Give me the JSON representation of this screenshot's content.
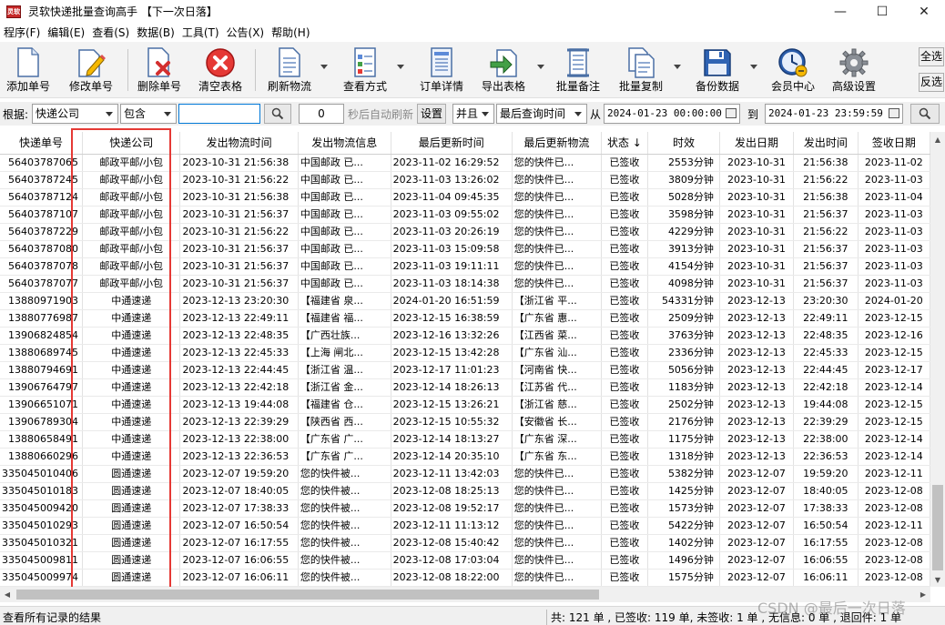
{
  "window": {
    "title": "灵软快递批量查询高手 【下一次日落】",
    "app_icon_text": "灵软",
    "minimize": "—",
    "maximize": "☐",
    "close": "✕"
  },
  "menu": [
    "程序(F)",
    "编辑(E)",
    "查看(S)",
    "数据(B)",
    "工具(T)",
    "公告(X)",
    "帮助(H)"
  ],
  "toolbar": {
    "buttons": [
      {
        "label": "添加单号",
        "icon": "add-document-icon"
      },
      {
        "label": "修改单号",
        "icon": "edit-pencil-icon"
      },
      {
        "label": "删除单号",
        "icon": "delete-document-icon"
      },
      {
        "label": "清空表格",
        "icon": "clear-red-x-icon"
      },
      {
        "label": "刷新物流",
        "icon": "refresh-document-icon"
      },
      {
        "label": "查看方式",
        "icon": "view-mode-icon"
      },
      {
        "label": "订单详情",
        "icon": "order-detail-icon"
      },
      {
        "label": "导出表格",
        "icon": "export-arrow-icon"
      },
      {
        "label": "批量备注",
        "icon": "batch-note-icon"
      },
      {
        "label": "批量复制",
        "icon": "batch-copy-icon"
      },
      {
        "label": "备份数据",
        "icon": "backup-floppy-icon"
      },
      {
        "label": "会员中心",
        "icon": "member-clock-icon"
      },
      {
        "label": "高级设置",
        "icon": "settings-gear-icon"
      }
    ],
    "select_all": "全选",
    "invert_select": "反选"
  },
  "filter": {
    "by_label": "根据:",
    "field": "快递公司",
    "mode": "包含",
    "keyword": "",
    "search_icon": "search-icon",
    "auto_refresh_value": "0",
    "auto_refresh_text": "秒后自动刷新",
    "settings": "设置",
    "logic": "并且",
    "time_field": "最后查询时间",
    "from_label": "从",
    "from": "2024-01-23 00:00:00",
    "to_label": "到",
    "to": "2024-01-23 23:59:59"
  },
  "table": {
    "columns": [
      "快递单号",
      "快递公司",
      "发出物流时间",
      "发出物流信息",
      "最后更新时间",
      "最后更新物流",
      "状态 ↓",
      "时效",
      "发出日期",
      "发出时间",
      "签收日期"
    ],
    "rows": [
      [
        "56403787065",
        "邮政平邮/小包",
        "2023-10-31 21:56:38",
        "中国邮政 已...",
        "2023-11-02 16:29:52",
        "您的快件已...",
        "已签收",
        "2553分钟",
        "2023-10-31",
        "21:56:38",
        "2023-11-02"
      ],
      [
        "56403787245",
        "邮政平邮/小包",
        "2023-10-31 21:56:22",
        "中国邮政 已...",
        "2023-11-03 13:26:02",
        "您的快件已...",
        "已签收",
        "3809分钟",
        "2023-10-31",
        "21:56:22",
        "2023-11-03"
      ],
      [
        "56403787124",
        "邮政平邮/小包",
        "2023-10-31 21:56:38",
        "中国邮政 已...",
        "2023-11-04 09:45:35",
        "您的快件已...",
        "已签收",
        "5028分钟",
        "2023-10-31",
        "21:56:38",
        "2023-11-04"
      ],
      [
        "56403787107",
        "邮政平邮/小包",
        "2023-10-31 21:56:37",
        "中国邮政 已...",
        "2023-11-03 09:55:02",
        "您的快件已...",
        "已签收",
        "3598分钟",
        "2023-10-31",
        "21:56:37",
        "2023-11-03"
      ],
      [
        "56403787229",
        "邮政平邮/小包",
        "2023-10-31 21:56:22",
        "中国邮政 已...",
        "2023-11-03 20:26:19",
        "您的快件已...",
        "已签收",
        "4229分钟",
        "2023-10-31",
        "21:56:22",
        "2023-11-03"
      ],
      [
        "56403787080",
        "邮政平邮/小包",
        "2023-10-31 21:56:37",
        "中国邮政 已...",
        "2023-11-03 15:09:58",
        "您的快件已...",
        "已签收",
        "3913分钟",
        "2023-10-31",
        "21:56:37",
        "2023-11-03"
      ],
      [
        "56403787078",
        "邮政平邮/小包",
        "2023-10-31 21:56:37",
        "中国邮政 已...",
        "2023-11-03 19:11:11",
        "您的快件已...",
        "已签收",
        "4154分钟",
        "2023-10-31",
        "21:56:37",
        "2023-11-03"
      ],
      [
        "56403787077",
        "邮政平邮/小包",
        "2023-10-31 21:56:37",
        "中国邮政 已...",
        "2023-11-03 18:14:38",
        "您的快件已...",
        "已签收",
        "4098分钟",
        "2023-10-31",
        "21:56:37",
        "2023-11-03"
      ],
      [
        "13880971903",
        "中通速递",
        "2023-12-13 23:20:30",
        "【福建省 泉...",
        "2024-01-20 16:51:59",
        "【浙江省 平...",
        "已签收",
        "54331分钟",
        "2023-12-13",
        "23:20:30",
        "2024-01-20"
      ],
      [
        "13880776987",
        "中通速递",
        "2023-12-13 22:49:11",
        "【福建省 福...",
        "2023-12-15 16:38:59",
        "【广东省 惠...",
        "已签收",
        "2509分钟",
        "2023-12-13",
        "22:49:11",
        "2023-12-15"
      ],
      [
        "13906824854",
        "中通速递",
        "2023-12-13 22:48:35",
        "【广西壮族...",
        "2023-12-16 13:32:26",
        "【江西省 菜...",
        "已签收",
        "3763分钟",
        "2023-12-13",
        "22:48:35",
        "2023-12-16"
      ],
      [
        "13880689745",
        "中通速递",
        "2023-12-13 22:45:33",
        "【上海 闸北...",
        "2023-12-15 13:42:28",
        "【广东省 汕...",
        "已签收",
        "2336分钟",
        "2023-12-13",
        "22:45:33",
        "2023-12-15"
      ],
      [
        "13880794691",
        "中通速递",
        "2023-12-13 22:44:45",
        "【浙江省 温...",
        "2023-12-17 11:01:23",
        "【河南省 快...",
        "已签收",
        "5056分钟",
        "2023-12-13",
        "22:44:45",
        "2023-12-17"
      ],
      [
        "13906764797",
        "中通速递",
        "2023-12-13 22:42:18",
        "【浙江省 金...",
        "2023-12-14 18:26:13",
        "【江苏省 代...",
        "已签收",
        "1183分钟",
        "2023-12-13",
        "22:42:18",
        "2023-12-14"
      ],
      [
        "13906651071",
        "中通速递",
        "2023-12-13 19:44:08",
        "【福建省 仓...",
        "2023-12-15 13:26:21",
        "【浙江省 慈...",
        "已签收",
        "2502分钟",
        "2023-12-13",
        "19:44:08",
        "2023-12-15"
      ],
      [
        "13906789304",
        "中通速递",
        "2023-12-13 22:39:29",
        "【陕西省 西...",
        "2023-12-15 10:55:32",
        "【安徽省 长...",
        "已签收",
        "2176分钟",
        "2023-12-13",
        "22:39:29",
        "2023-12-15"
      ],
      [
        "13880658491",
        "中通速递",
        "2023-12-13 22:38:00",
        "【广东省 广...",
        "2023-12-14 18:13:27",
        "【广东省 深...",
        "已签收",
        "1175分钟",
        "2023-12-13",
        "22:38:00",
        "2023-12-14"
      ],
      [
        "13880660296",
        "中通速递",
        "2023-12-13 22:36:53",
        "【广东省 广...",
        "2023-12-14 20:35:10",
        "【广东省 东...",
        "已签收",
        "1318分钟",
        "2023-12-13",
        "22:36:53",
        "2023-12-14"
      ],
      [
        "335045010406",
        "圆通速递",
        "2023-12-07 19:59:20",
        "您的快件被...",
        "2023-12-11 13:42:03",
        "您的快件已...",
        "已签收",
        "5382分钟",
        "2023-12-07",
        "19:59:20",
        "2023-12-11"
      ],
      [
        "335045010183",
        "圆通速递",
        "2023-12-07 18:40:05",
        "您的快件被...",
        "2023-12-08 18:25:13",
        "您的快件已...",
        "已签收",
        "1425分钟",
        "2023-12-07",
        "18:40:05",
        "2023-12-08"
      ],
      [
        "335045009420",
        "圆通速递",
        "2023-12-07 17:38:33",
        "您的快件被...",
        "2023-12-08 19:52:17",
        "您的快件已...",
        "已签收",
        "1573分钟",
        "2023-12-07",
        "17:38:33",
        "2023-12-08"
      ],
      [
        "335045010293",
        "圆通速递",
        "2023-12-07 16:50:54",
        "您的快件被...",
        "2023-12-11 11:13:12",
        "您的快件已...",
        "已签收",
        "5422分钟",
        "2023-12-07",
        "16:50:54",
        "2023-12-11"
      ],
      [
        "335045010321",
        "圆通速递",
        "2023-12-07 16:17:55",
        "您的快件被...",
        "2023-12-08 15:40:42",
        "您的快件已...",
        "已签收",
        "1402分钟",
        "2023-12-07",
        "16:17:55",
        "2023-12-08"
      ],
      [
        "335045009811",
        "圆通速递",
        "2023-12-07 16:06:55",
        "您的快件被...",
        "2023-12-08 17:03:04",
        "您的快件已...",
        "已签收",
        "1496分钟",
        "2023-12-07",
        "16:06:55",
        "2023-12-08"
      ],
      [
        "335045009974",
        "圆通速递",
        "2023-12-07 16:06:11",
        "您的快件被...",
        "2023-12-08 18:22:00",
        "您的快件已...",
        "已签收",
        "1575分钟",
        "2023-12-07",
        "16:06:11",
        "2023-12-08"
      ]
    ]
  },
  "status": {
    "left": "查看所有记录的结果",
    "right": "共: 121 单 , 已签收: 119 单, 未签收: 1 单 , 无信息: 0 单 , 退回件: 1 单"
  },
  "watermark": "CSDN @最后一次日落",
  "colors": {
    "highlight_border": "#e53935"
  }
}
